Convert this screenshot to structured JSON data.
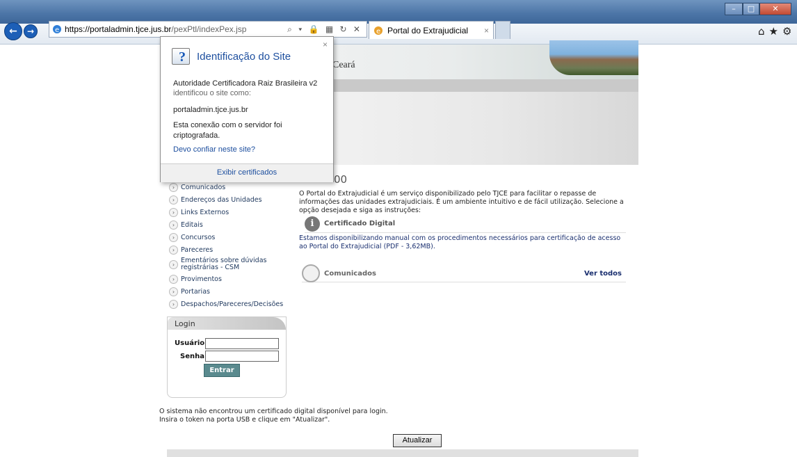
{
  "browser": {
    "url_domain": "https://portaladmin.tjce.jus.br",
    "url_path": "/pexPtl/indexPex.jsp",
    "tab_title": "Portal do Extrajudicial",
    "address_tools": "⌕ ▾ 🔒 ▦ ↻ ✕",
    "tab_close": "×",
    "win_min": "–",
    "win_max": "□",
    "win_close": "✕",
    "right_icons": "⌂★⚙"
  },
  "page": {
    "banner_text": "Ceará",
    "hero_title": "00",
    "menu": [
      "Comunicados",
      "Endereços das Unidades",
      "Links Externos",
      "Editais",
      "Concursos",
      "Pareceres",
      "Ementários sobre dúvidas registrárias - CSM",
      "Provimentos",
      "Portarias",
      "Despachos/Pareceres/Decisões"
    ],
    "login": {
      "header": "Login",
      "user_label": "Usuário:",
      "pass_label": "Senha:",
      "submit": "Entrar"
    },
    "intro": "O Portal do Extrajudicial é um serviço disponibilizado pelo TJCE para facilitar o repasse de informações das unidades extrajudiciais. É um ambiente intuitivo e de fácil utilização. Selecione a opção desejada e siga as instruções:",
    "cert_title": "Certificado Digital",
    "cert_text": "Estamos disponibilizando manual com os procedimentos necessários para certificação de acesso ao Portal do Extrajudicial (PDF - 3,62MB).",
    "comunicados_title": "Comunicados",
    "ver_todos": "Ver todos",
    "notice_line1": "O sistema não encontrou um certificado digital disponível para login.",
    "notice_line2": "Insira o token na porta USB e clique em \"Atualizar\".",
    "atualizar": "Atualizar"
  },
  "popup": {
    "title": "Identificação do Site",
    "authority": "Autoridade Certificadora Raiz Brasileira v2",
    "identified": "identificou o site como:",
    "site": "portaladmin.tjce.jus.br",
    "encrypted": "Esta conexão com o servidor foi criptografada.",
    "trust_link": "Devo confiar neste site?",
    "view_certs": "Exibir certificados",
    "close": "×"
  }
}
